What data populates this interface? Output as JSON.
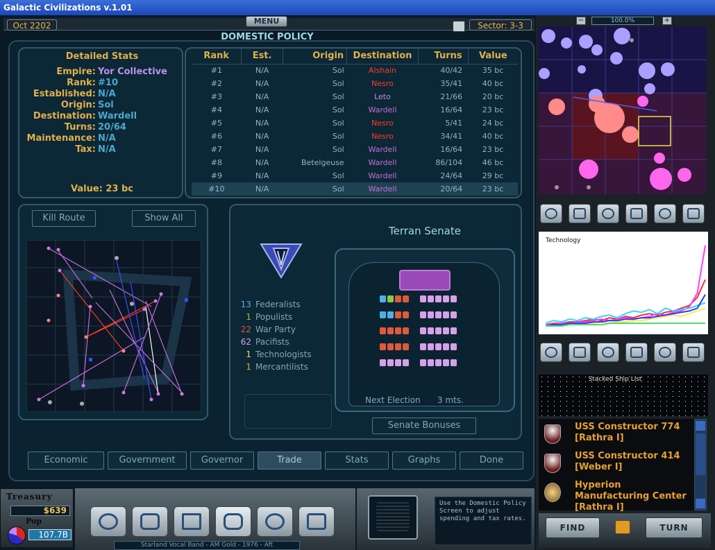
{
  "window": {
    "title": "Galactic Civilizations v.1.01"
  },
  "top": {
    "date": "Oct 2202",
    "menu": "MENU",
    "sector": "Sector: 3-3",
    "zoom": "100.0%"
  },
  "screen": {
    "title": "DOMESTIC POLICY"
  },
  "detailed_stats": {
    "title": "Detailed Stats",
    "rows": [
      {
        "label": "Empire:",
        "value": "Yor Collective"
      },
      {
        "label": "Rank:",
        "value": "#10"
      },
      {
        "label": "Established:",
        "value": "N/A"
      },
      {
        "label": "Origin:",
        "value": "Sol"
      },
      {
        "label": "Destination:",
        "value": "Wardell"
      },
      {
        "label": "Turns:",
        "value": "20/64"
      },
      {
        "label": "Maintenance:",
        "value": "N/A"
      },
      {
        "label": "Tax:",
        "value": "N/A"
      }
    ],
    "value": "Value: 23 bc"
  },
  "routes_table": {
    "headers": [
      "Rank",
      "Est.",
      "Origin",
      "Destination",
      "Turns",
      "Value"
    ],
    "rows": [
      {
        "rank": "#1",
        "est": "N/A",
        "origin": "Sol",
        "dest": "Alshain",
        "turns": "40/42",
        "value": "35 bc",
        "dest_color": "#ff3b2a"
      },
      {
        "rank": "#2",
        "est": "N/A",
        "origin": "Sol",
        "dest": "Nesro",
        "turns": "35/41",
        "value": "40 bc",
        "dest_color": "#ff3b2a"
      },
      {
        "rank": "#3",
        "est": "N/A",
        "origin": "Sol",
        "dest": "Leto",
        "turns": "21/66",
        "value": "20 bc",
        "dest_color": "#b892e0"
      },
      {
        "rank": "#4",
        "est": "N/A",
        "origin": "Sol",
        "dest": "Wardell",
        "turns": "16/64",
        "value": "23 bc",
        "dest_color": "#c06fd8"
      },
      {
        "rank": "#5",
        "est": "N/A",
        "origin": "Sol",
        "dest": "Nesro",
        "turns": "5/41",
        "value": "24 bc",
        "dest_color": "#ff3b2a"
      },
      {
        "rank": "#6",
        "est": "N/A",
        "origin": "Sol",
        "dest": "Nesro",
        "turns": "34/41",
        "value": "40 bc",
        "dest_color": "#ff3b2a"
      },
      {
        "rank": "#7",
        "est": "N/A",
        "origin": "Sol",
        "dest": "Wardell",
        "turns": "16/64",
        "value": "23 bc",
        "dest_color": "#c06fd8"
      },
      {
        "rank": "#8",
        "est": "N/A",
        "origin": "Betelgeuse",
        "dest": "Wardell",
        "turns": "86/104",
        "value": "46 bc",
        "dest_color": "#c06fd8"
      },
      {
        "rank": "#9",
        "est": "N/A",
        "origin": "Sol",
        "dest": "Wardell",
        "turns": "24/64",
        "value": "29 bc",
        "dest_color": "#c06fd8"
      },
      {
        "rank": "#10",
        "est": "N/A",
        "origin": "Sol",
        "dest": "Wardell",
        "turns": "20/64",
        "value": "23 bc",
        "dest_color": "#c06fd8"
      }
    ]
  },
  "route_buttons": {
    "kill": "Kill Route",
    "show_all": "Show All"
  },
  "senate": {
    "title": "Terran Senate",
    "parties": [
      {
        "count": "13",
        "name": "Federalists",
        "color": "#4fb0e8"
      },
      {
        "count": "1",
        "name": "Populists",
        "color": "#86c942"
      },
      {
        "count": "22",
        "name": "War Party",
        "color": "#e05a3a"
      },
      {
        "count": "62",
        "name": "Pacifists",
        "color": "#d7a0e8"
      },
      {
        "count": "1",
        "name": "Technologists",
        "color": "#f0e070"
      },
      {
        "count": "1",
        "name": "Mercantilists",
        "color": "#f0a040"
      }
    ],
    "next_election_label": "Next Election",
    "next_election_value": "3 mts.",
    "bonuses_button": "Senate Bonuses"
  },
  "tabs": [
    "Economic",
    "Government",
    "Governor",
    "Trade",
    "Stats",
    "Graphs",
    "Done"
  ],
  "active_tab": "Trade",
  "treasury": {
    "label": "Treasury",
    "money": "$639",
    "pop_label": "Pop",
    "pop": "107.7B"
  },
  "hint": "Use the Domestic Policy Screen to adjust spending and tax rates.",
  "music": "Starland Vocal Band - AM Gold - 1976 - Aft",
  "graph": {
    "label": "Technology"
  },
  "ship_list": {
    "title": "Stacked Ship List",
    "items": [
      {
        "name": "USS Constructor 774",
        "loc": "[Rathra I]"
      },
      {
        "name": "USS Constructor 414",
        "loc": "[Weber I]"
      },
      {
        "name": "Hyperion Manufacturing Center",
        "loc": "[Rathra I]"
      }
    ]
  },
  "buttons": {
    "find": "FIND",
    "turn": "TURN"
  },
  "chart_data": {
    "type": "line",
    "title": "Technology",
    "xlabel": "",
    "ylabel": "",
    "x": [
      0,
      1,
      2,
      3,
      4,
      5,
      6,
      7,
      8,
      9,
      10,
      11,
      12,
      13,
      14,
      15,
      16,
      17,
      18,
      19,
      20
    ],
    "series": [
      {
        "color": "#ff2b2b",
        "values": [
          2,
          3,
          3,
          4,
          4,
          5,
          6,
          5,
          7,
          6,
          8,
          7,
          9,
          10,
          9,
          11,
          12,
          14,
          16,
          22,
          35
        ]
      },
      {
        "color": "#ff3bff",
        "values": [
          2,
          2,
          3,
          3,
          4,
          4,
          5,
          6,
          5,
          6,
          7,
          6,
          7,
          8,
          10,
          9,
          11,
          12,
          15,
          25,
          60
        ]
      },
      {
        "color": "#2cd8ff",
        "values": [
          3,
          5,
          4,
          6,
          5,
          7,
          6,
          8,
          9,
          7,
          10,
          12,
          11,
          13,
          10,
          14,
          12,
          13,
          14,
          16,
          18
        ]
      },
      {
        "color": "#f8f040",
        "values": [
          1,
          2,
          2,
          3,
          2,
          3,
          3,
          4,
          3,
          4,
          4,
          5,
          5,
          6,
          7,
          8,
          9,
          8,
          10,
          12,
          14
        ]
      },
      {
        "color": "#2a3aff",
        "values": [
          1,
          2,
          2,
          3,
          3,
          3,
          4,
          4,
          5,
          5,
          6,
          6,
          7,
          7,
          8,
          9,
          10,
          11,
          12,
          14,
          24
        ]
      },
      {
        "color": "#4ad86a",
        "values": [
          1,
          1,
          1,
          2,
          2,
          2,
          2,
          2,
          3,
          3,
          3,
          3,
          3,
          3,
          3,
          3,
          3,
          3,
          3,
          3,
          3
        ]
      }
    ],
    "ylim": [
      0,
      65
    ],
    "grid": true
  }
}
